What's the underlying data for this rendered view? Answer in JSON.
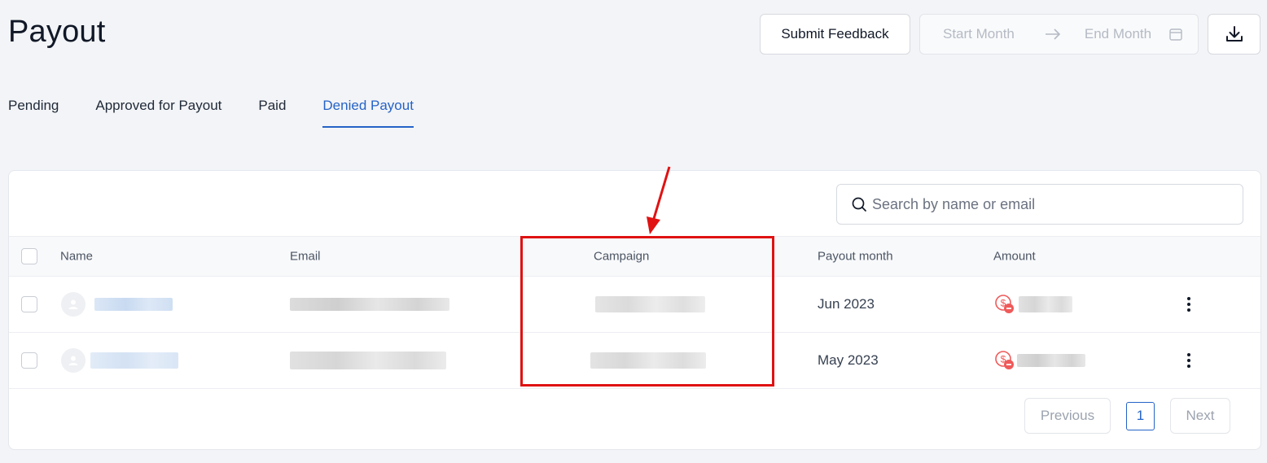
{
  "page": {
    "title": "Payout"
  },
  "toolbar": {
    "feedback_label": "Submit Feedback",
    "start_month_placeholder": "Start Month",
    "end_month_placeholder": "End Month",
    "download_icon": "download-icon",
    "calendar_icon": "calendar-icon"
  },
  "tabs": [
    {
      "label": "Pending",
      "active": false
    },
    {
      "label": "Approved for Payout",
      "active": false
    },
    {
      "label": "Paid",
      "active": false
    },
    {
      "label": "Denied Payout",
      "active": true
    }
  ],
  "search": {
    "placeholder": "Search by name or email"
  },
  "table": {
    "columns": [
      "Name",
      "Email",
      "Campaign",
      "Payout month",
      "Amount"
    ],
    "rows": [
      {
        "payout_month": "Jun 2023",
        "amount_icon": "denied-dollar-icon"
      },
      {
        "payout_month": "May 2023",
        "amount_icon": "denied-dollar-icon"
      }
    ]
  },
  "pagination": {
    "previous": "Previous",
    "current": "1",
    "next": "Next"
  },
  "colors": {
    "accent": "#2563c7",
    "annotation": "#e01212",
    "denied": "#ef5a5a"
  }
}
